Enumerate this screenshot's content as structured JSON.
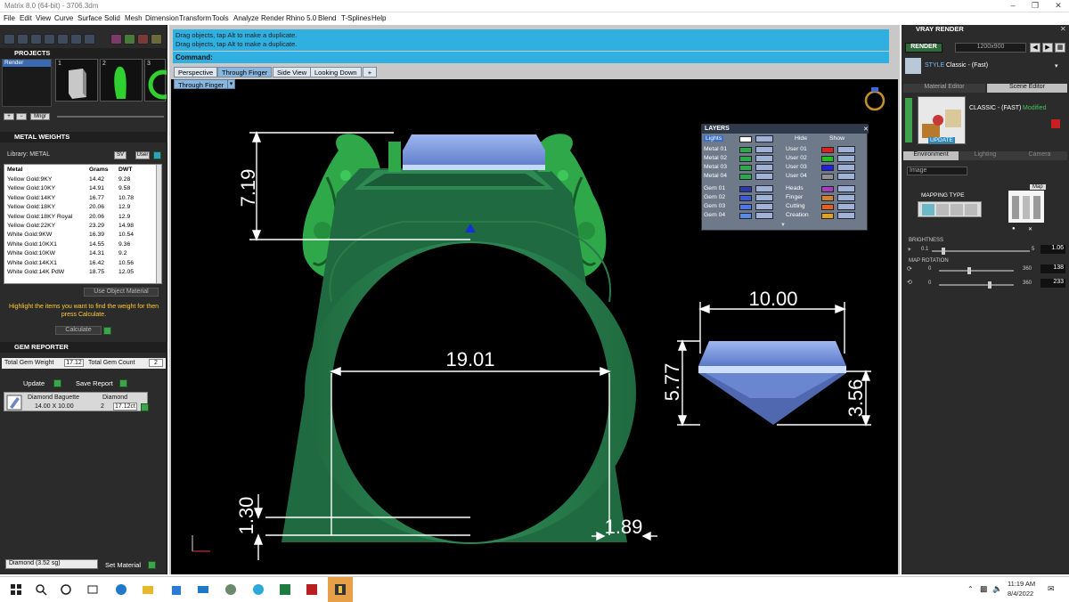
{
  "app": {
    "title": "Matrix 8.0 (64-bit) - 3706.3dm"
  },
  "menu": [
    "File",
    "Edit",
    "View",
    "Curve",
    "Surface",
    "Solid",
    "Mesh",
    "Dimension",
    "Transform",
    "Tools",
    "Analyze",
    "Render",
    "Rhino 5.0",
    "Blend",
    "T-Splines",
    "Help"
  ],
  "projects": {
    "title": "PROJECTS",
    "render_label": "Render",
    "thumbs": [
      "1",
      "2",
      "3"
    ],
    "mngr_label": "Mngr"
  },
  "metal_weights": {
    "title": "METAL WEIGHTS",
    "library_label": "Library: METAL",
    "sv_label": "SV",
    "user_label": "User",
    "columns": [
      "Metal",
      "Grams",
      "DWT"
    ],
    "rows": [
      [
        "Yellow Gold:9KY",
        "14.42",
        "9.28"
      ],
      [
        "Yellow Gold:10KY",
        "14.91",
        "9.58"
      ],
      [
        "Yellow Gold:14KY",
        "16.77",
        "10.78"
      ],
      [
        "Yellow Gold:18KY",
        "20.06",
        "12.9"
      ],
      [
        "Yellow Gold:18KY Royal",
        "20.06",
        "12.9"
      ],
      [
        "Yellow Gold:22KY",
        "23.29",
        "14.98"
      ],
      [
        "White Gold:9KW",
        "16.39",
        "10.54"
      ],
      [
        "White Gold:10KX1",
        "14.55",
        "9.36"
      ],
      [
        "White Gold:10KW",
        "14.31",
        "9.2"
      ],
      [
        "White Gold:14KX1",
        "16.42",
        "10.56"
      ],
      [
        "White Gold:14K PdW",
        "18.75",
        "12.05"
      ]
    ],
    "use_object_label": "Use Object Material",
    "hint": "Highlight the items you want to find the weight for then press Calculate.",
    "calculate_label": "Calculate"
  },
  "gem_reporter": {
    "title": "GEM REPORTER",
    "total_weight_label": "Total Gem Weight",
    "total_weight": "17.12",
    "total_count_label": "Total Gem Count",
    "total_count": "2",
    "update_label": "Update",
    "save_label": "Save Report",
    "gem": {
      "name": "Diamond Baguette",
      "size": "14.00 X 10.00",
      "material": "Diamond",
      "count": "2",
      "weight": "17.12ct"
    }
  },
  "material": {
    "selected": "Diamond (3.52 sg)",
    "set_label": "Set Material"
  },
  "messages": [
    "Drag objects, tap Alt to make a duplicate.",
    "Drag objects, tap Alt to make a duplicate."
  ],
  "command_label": "Command:",
  "tabs": [
    "Perspective",
    "Through Finger",
    "Side View",
    "Looking Down"
  ],
  "tab_add": "+",
  "view_label": "Through Finger",
  "dimensions": {
    "top_height": "7.19",
    "width_gem": "10.00",
    "inner_diameter": "19.01",
    "gem_height": "5.77",
    "pavilion": "3.56",
    "band_thickness": "1.30",
    "shank_width": "1.89"
  },
  "layers": {
    "title": "LAYERS",
    "lights_label": "Lights",
    "hide_label": "Hide",
    "show_label": "Show",
    "left": [
      "Metal 01",
      "Metal 02",
      "Metal 03",
      "Metal 04",
      "Gem 01",
      "Gem 02",
      "Gem 03",
      "Gem 04"
    ],
    "right": [
      "User 01",
      "User 02",
      "User 03",
      "User 04",
      "Heads",
      "Finger",
      "Cutting",
      "Creation"
    ],
    "left_colors": [
      "#2aa84a",
      "#2aa84a",
      "#2aa84a",
      "#2aa84a",
      "#2a3aa8",
      "#3a58d8",
      "#4a78e8",
      "#5a8ae8"
    ],
    "right_colors": [
      "#e02020",
      "#20c020",
      "#2020e0",
      "#909090",
      "#a040c0",
      "#d08030",
      "#e06020",
      "#e0a020"
    ]
  },
  "vray": {
    "title": "VRAY RENDER",
    "render_label": "RENDER",
    "resolution": "1200x900",
    "style_label": "STYLE",
    "style_value": "Classic - (Fast)",
    "tabs": [
      "Material Editor",
      "Scene Editor"
    ],
    "preset_name": "CLASSIC - (FAST)",
    "modified": "Modified",
    "update_label": "UPDATE",
    "env_tabs": [
      "Environment",
      "Lighting",
      "Camera"
    ],
    "env_select": "Image",
    "mapping_label": "MAPPING TYPE",
    "map_label": "Map",
    "brightness_label": "BRIGHTNESS",
    "brightness_min": "0.1",
    "brightness_max": "5",
    "brightness_value": "1.06",
    "rotation_label": "MAP ROTATION",
    "rot1_min": "0",
    "rot1_max": "360",
    "rot1_value": "138",
    "rot2_min": "0",
    "rot2_max": "360",
    "rot2_value": "233",
    "brightness_level": 0.1,
    "rot1_level": 0.38,
    "rot2_level": 0.65
  },
  "taskbar": {
    "time": "11:19 AM",
    "date": "8/4/2022"
  }
}
